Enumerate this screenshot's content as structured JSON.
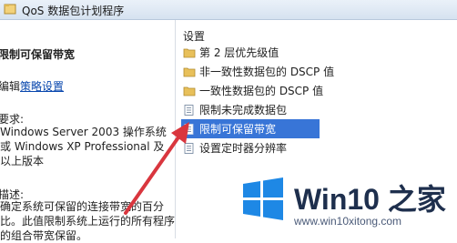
{
  "window": {
    "title": "QoS 数据包计划程序"
  },
  "left_pane": {
    "heading": "限制可保留带宽",
    "edit_prefix": "编辑",
    "edit_link": "策略设置",
    "requirements_label": "要求:",
    "requirements_text": "Windows Server 2003 操作系统或 Windows XP Professional 及以上版本",
    "description_label": "描述:",
    "description_text": "确定系统可保留的连接带宽的百分比。此值限制系统上运行的所有程序的组合带宽保留。"
  },
  "right_pane": {
    "column_header": "设置",
    "items": [
      {
        "label": "第 2 层优先级值",
        "icon": "folder-icon",
        "selected": false
      },
      {
        "label": "非一致性数据包的 DSCP 值",
        "icon": "folder-icon",
        "selected": false
      },
      {
        "label": "一致性数据包的 DSCP 值",
        "icon": "folder-icon",
        "selected": false
      },
      {
        "label": "限制未完成数据包",
        "icon": "policy-setting-icon",
        "selected": false
      },
      {
        "label": "限制可保留带宽",
        "icon": "policy-setting-icon",
        "selected": true
      },
      {
        "label": "设置定时器分辨率",
        "icon": "policy-setting-icon",
        "selected": false
      }
    ]
  },
  "watermark": {
    "brand": "Win10 之家",
    "url": "www.win10xitong.com"
  },
  "colors": {
    "selection": "#3875d7",
    "arrow": "#d9363e",
    "folder": "#e8c05a",
    "logo": "#1e88e5"
  }
}
